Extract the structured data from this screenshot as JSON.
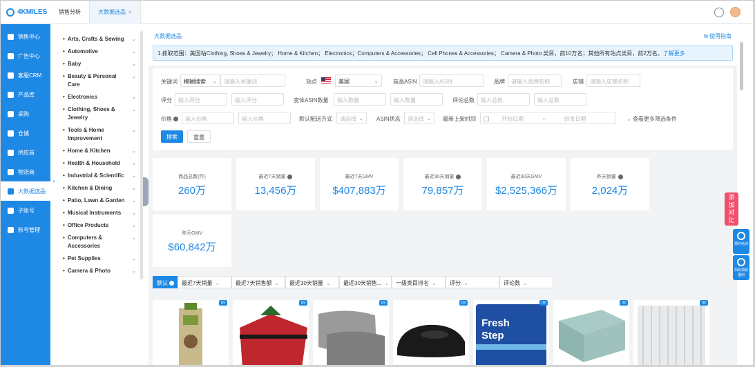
{
  "brand": {
    "name": "4KMILES"
  },
  "nav": {
    "items": [
      {
        "label": "销售中心"
      },
      {
        "label": "广告中心"
      },
      {
        "label": "客服CRM"
      },
      {
        "label": "产品库"
      },
      {
        "label": "采购"
      },
      {
        "label": "仓储"
      },
      {
        "label": "供应商"
      },
      {
        "label": "物流商"
      },
      {
        "label": "大数据选品"
      },
      {
        "label": "子账号"
      },
      {
        "label": "账号管理"
      }
    ],
    "active_index": 8
  },
  "tabs": [
    {
      "label": "销售分析"
    },
    {
      "label": "大数据选品",
      "close": "×"
    }
  ],
  "categories": [
    {
      "label": "Arts, Crafts & Sewing"
    },
    {
      "label": "Automotive"
    },
    {
      "label": "Baby"
    },
    {
      "label": "Beauty & Personal Care"
    },
    {
      "label": "Electronics"
    },
    {
      "label": "Clothing, Shoes & Jewelry"
    },
    {
      "label": "Tools & Home Improvement"
    },
    {
      "label": "Home & Kitchen"
    },
    {
      "label": "Health & Household"
    },
    {
      "label": "Industrial & Scientific"
    },
    {
      "label": "Kitchen & Dining"
    },
    {
      "label": "Patio, Lawn & Garden"
    },
    {
      "label": "Musical Instruments"
    },
    {
      "label": "Office Products"
    },
    {
      "label": "Computers & Accessories"
    },
    {
      "label": "Pet Supplies"
    },
    {
      "label": "Camera & Photo"
    }
  ],
  "page": {
    "title": "大数据选品",
    "guide": "使用指南",
    "notice": "1.抓取范围：美国站Clothing, Shoes & Jewelry； Home & Kitchen； Electronics；Computers & Accessories； Cell Phones & Accessories； Camera & Photo 类目，前10万名；其他所有站点类目，前2万名。",
    "notice_more": "了解更多"
  },
  "filters": {
    "keyword_label": "关键词",
    "keyword_mode": "模糊搜索",
    "keyword_placeholder": "请输入关键词",
    "site_label": "站点",
    "site_value": "美国",
    "asin_label": "商品ASIN",
    "asin_placeholder": "请输入ASIN",
    "brand_label": "品牌",
    "brand_placeholder": "请输入品牌名称",
    "shop_label": "店铺",
    "shop_placeholder": "请输入店铺名称",
    "rating_label": "评分",
    "rating_min": "输入评分",
    "rating_max": "输入评分",
    "variant_label": "变体ASIN数量",
    "variant_min": "输入数量",
    "variant_max": "输入数量",
    "reviews_label": "评论总数",
    "reviews_min": "输入总数",
    "reviews_max": "输入总数",
    "price_label": "价格",
    "price_min": "输入价格",
    "price_max": "输入价格",
    "delivery_label": "默认配送方式",
    "delivery_value": "请选择",
    "asin_status_label": "ASIN状态",
    "asin_status_value": "请选择",
    "listed_label": "最新上架时间",
    "date_start": "开始日期",
    "date_sep": "-",
    "date_end": "结束日期",
    "more": "查看更多筛选条件",
    "search_btn": "搜索",
    "reset_btn": "重置"
  },
  "stats": [
    {
      "label": "商品总数(件)",
      "value": "260万",
      "help": false
    },
    {
      "label": "最近7天销量",
      "value": "13,456万",
      "help": true
    },
    {
      "label": "最近7天GMV",
      "value": "$407,883万",
      "help": false
    },
    {
      "label": "最近30天销量",
      "value": "79,857万",
      "help": true
    },
    {
      "label": "最近30天GMV",
      "value": "$2,525,366万",
      "help": false
    },
    {
      "label": "昨天销量",
      "value": "2,024万",
      "help": true
    },
    {
      "label": "昨天GMV",
      "value": "$60,842万",
      "help": false
    }
  ],
  "sort": [
    {
      "label": "默认",
      "active": true
    },
    {
      "label": "最近7天销量"
    },
    {
      "label": "最近7天销售额"
    },
    {
      "label": "最近30天销量"
    },
    {
      "label": "最近30天销售..."
    },
    {
      "label": "一级类目排名"
    },
    {
      "label": "评分"
    },
    {
      "label": "评论数"
    }
  ],
  "products": [
    {
      "flag": "us",
      "icon": "dog-waste-bags-image",
      "color": "#7a9a3a"
    },
    {
      "flag": "us",
      "icon": "christmas-tree-bag-image",
      "color": "#c0262d"
    },
    {
      "flag": "us",
      "icon": "silk-pillowcase-image",
      "color": "#8e8e8e"
    },
    {
      "flag": "us",
      "icon": "clog-shoe-image",
      "color": "#1a1a1a"
    },
    {
      "flag": "us",
      "icon": "fresh-step-litter-image",
      "color": "#1f4fa3"
    },
    {
      "flag": "us",
      "icon": "bed-sheets-image",
      "color": "#9fc2bf"
    },
    {
      "flag": "us",
      "icon": "shower-curtain-image",
      "color": "#cfd3d6"
    }
  ],
  "widgets": {
    "compare": "添加对比",
    "w1": "预约培训",
    "w2": "扫码领取福利"
  },
  "colors": {
    "primary": "#1e88e5",
    "accent": "#f1506c",
    "bg": "#f2f3f5"
  }
}
